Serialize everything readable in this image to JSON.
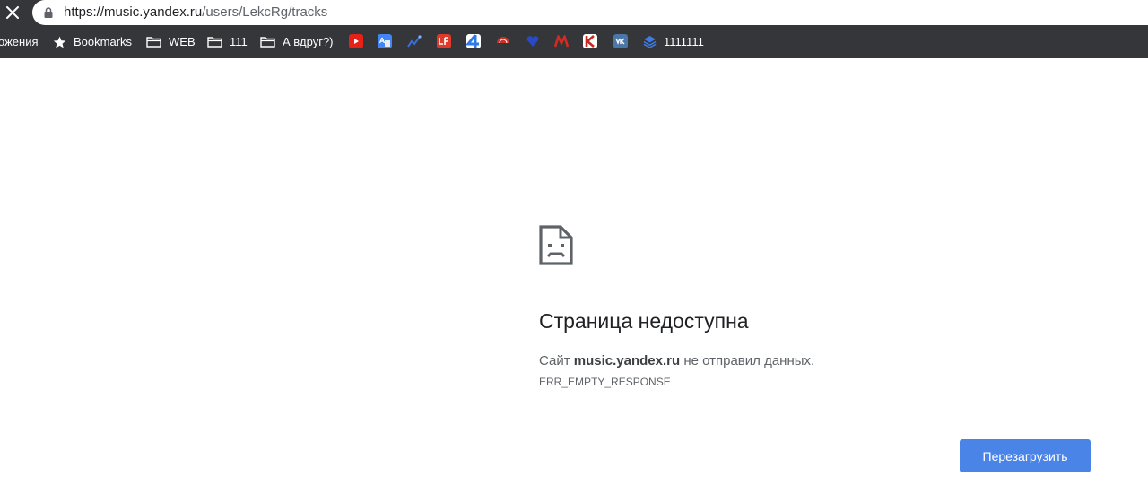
{
  "browser": {
    "url_host": "https://music.yandex.ru",
    "url_path": "/users/LekcRg/tracks"
  },
  "bookmarks_bar": {
    "items": [
      {
        "label": "ожения",
        "icon": "none"
      },
      {
        "label": "Bookmarks",
        "icon": "star-icon"
      },
      {
        "label": "WEB",
        "icon": "folder-icon"
      },
      {
        "label": "111",
        "icon": "folder-icon"
      },
      {
        "label": "А вдруг?)",
        "icon": "folder-icon"
      },
      {
        "label": "",
        "icon": "youtube-icon",
        "color": "#e62117"
      },
      {
        "label": "",
        "icon": "google-translate-icon",
        "color": "#4285f4"
      },
      {
        "label": "",
        "icon": "chart-icon",
        "color": "#3b6fd8"
      },
      {
        "label": "",
        "icon": "uf-icon",
        "color": "#e03a2a"
      },
      {
        "label": "",
        "icon": "channel-4-icon",
        "color": "#2f7be4"
      },
      {
        "label": "",
        "icon": "umbrella-icon",
        "color": "#c4352a"
      },
      {
        "label": "",
        "icon": "heart-icon",
        "color": "#2949c9"
      },
      {
        "label": "",
        "icon": "metro-icon",
        "color": "#d52b1e"
      },
      {
        "label": "",
        "icon": "k-icon",
        "color": "#c8281e"
      },
      {
        "label": "",
        "icon": "vk-icon",
        "color": "#4a76a8"
      },
      {
        "label": "1111111",
        "icon": "layers-icon",
        "color": "#3d7be6"
      }
    ]
  },
  "error": {
    "title": "Страница недоступна",
    "desc_before": "Сайт ",
    "desc_host": "music.yandex.ru",
    "desc_after": " не отправил данных.",
    "code": "ERR_EMPTY_RESPONSE",
    "reload_label": "Перезагрузить"
  },
  "colors": {
    "toolbar_bg": "#35363a",
    "button_bg": "#4b84e7"
  }
}
